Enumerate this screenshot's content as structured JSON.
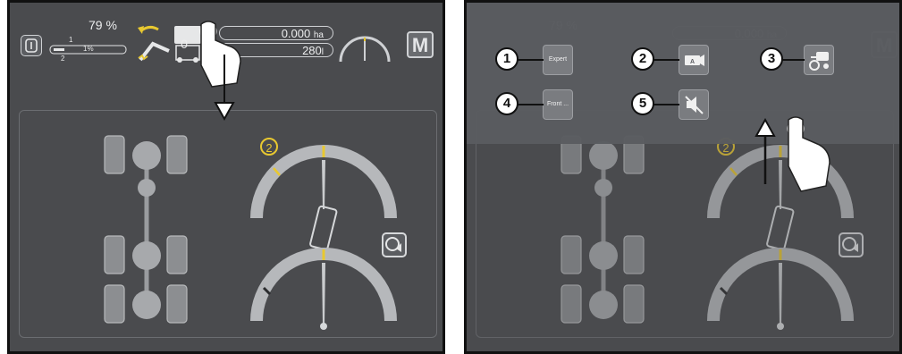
{
  "status_bar": {
    "fill_percent": "79 %",
    "level_scale": [
      "1",
      "1%",
      "2"
    ],
    "counter_value": "0",
    "area_value": "0.000",
    "area_unit": "ha",
    "volume_value": "280",
    "volume_unit": "l",
    "mode_label": "M"
  },
  "steering": {
    "gauge_badge": "2",
    "gauge_badge_color": "#e8c830"
  },
  "quick_menu": {
    "items": [
      {
        "callout": "1",
        "label": "Expert",
        "icon": "expert-icon"
      },
      {
        "callout": "2",
        "label": "",
        "icon": "camera-icon"
      },
      {
        "callout": "3",
        "label": "",
        "icon": "tractor-steer-icon"
      },
      {
        "callout": "4",
        "label": "Front ...",
        "icon": "front-icon"
      },
      {
        "callout": "5",
        "label": "",
        "icon": "mute-icon"
      }
    ]
  },
  "colors": {
    "screen_bg": "#4a4b4e",
    "accent_yellow": "#e8c830",
    "control_white": "#cfd1d4"
  }
}
